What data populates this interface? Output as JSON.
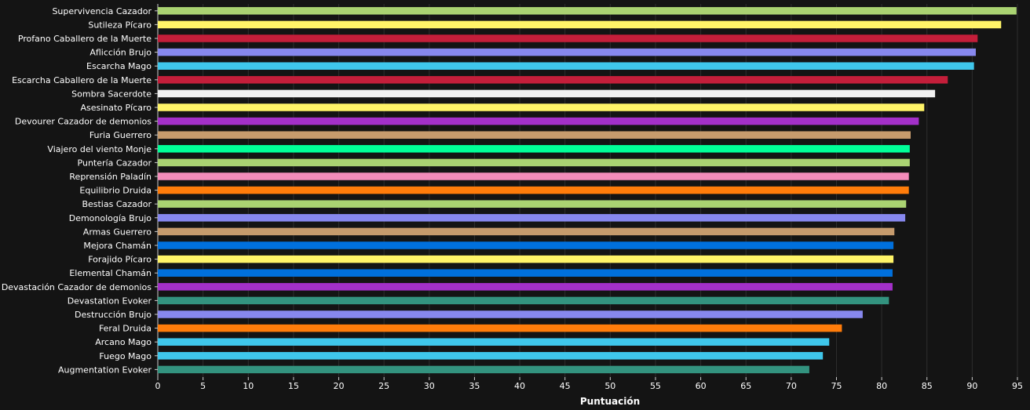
{
  "chart_data": {
    "type": "bar",
    "orientation": "horizontal",
    "xlabel": "Puntuación",
    "ylabel": "",
    "xlim": [
      0,
      95
    ],
    "xticks": [
      0,
      5,
      10,
      15,
      20,
      25,
      30,
      35,
      40,
      45,
      50,
      55,
      60,
      65,
      70,
      75,
      80,
      85,
      90,
      95
    ],
    "grid": true,
    "background": "#141414",
    "categories": [
      "Supervivencia Cazador",
      "Sutileza Pícaro",
      "Profano Caballero de la Muerte",
      "Aflicción Brujo",
      "Escarcha Mago",
      "Escarcha Caballero de la Muerte",
      "Sombra Sacerdote",
      "Asesinato Pícaro",
      "Devourer Cazador de demonios",
      "Furia Guerrero",
      "Viajero del viento Monje",
      "Puntería Cazador",
      "Reprensión Paladín",
      "Equilibrio Druida",
      "Bestias Cazador",
      "Demonología Brujo",
      "Armas Guerrero",
      "Mejora Chamán",
      "Forajido Pícaro",
      "Elemental Chamán",
      "Devastación Cazador de demonios",
      "Devastation Evoker",
      "Destrucción Brujo",
      "Feral Druida",
      "Arcano Mago",
      "Fuego Mago",
      "Augmentation Evoker"
    ],
    "values": [
      94.9,
      93.2,
      90.6,
      90.4,
      90.2,
      87.3,
      85.9,
      84.7,
      84.1,
      83.2,
      83.1,
      83.1,
      83.0,
      83.0,
      82.7,
      82.6,
      81.4,
      81.3,
      81.3,
      81.2,
      81.2,
      80.8,
      77.9,
      75.6,
      74.2,
      73.5,
      72.0
    ],
    "colors": [
      "#AAD372",
      "#FFF468",
      "#C41E3A",
      "#8788EE",
      "#3FC7EB",
      "#C41E3A",
      "#F0F0F0",
      "#FFF468",
      "#A330C9",
      "#C69B6D",
      "#00FF98",
      "#AAD372",
      "#F48CBA",
      "#FF7C0A",
      "#AAD372",
      "#8788EE",
      "#C69B6D",
      "#0070DD",
      "#FFF468",
      "#0070DD",
      "#A330C9",
      "#33937F",
      "#8788EE",
      "#FF7C0A",
      "#3FC7EB",
      "#3FC7EB",
      "#33937F"
    ]
  }
}
